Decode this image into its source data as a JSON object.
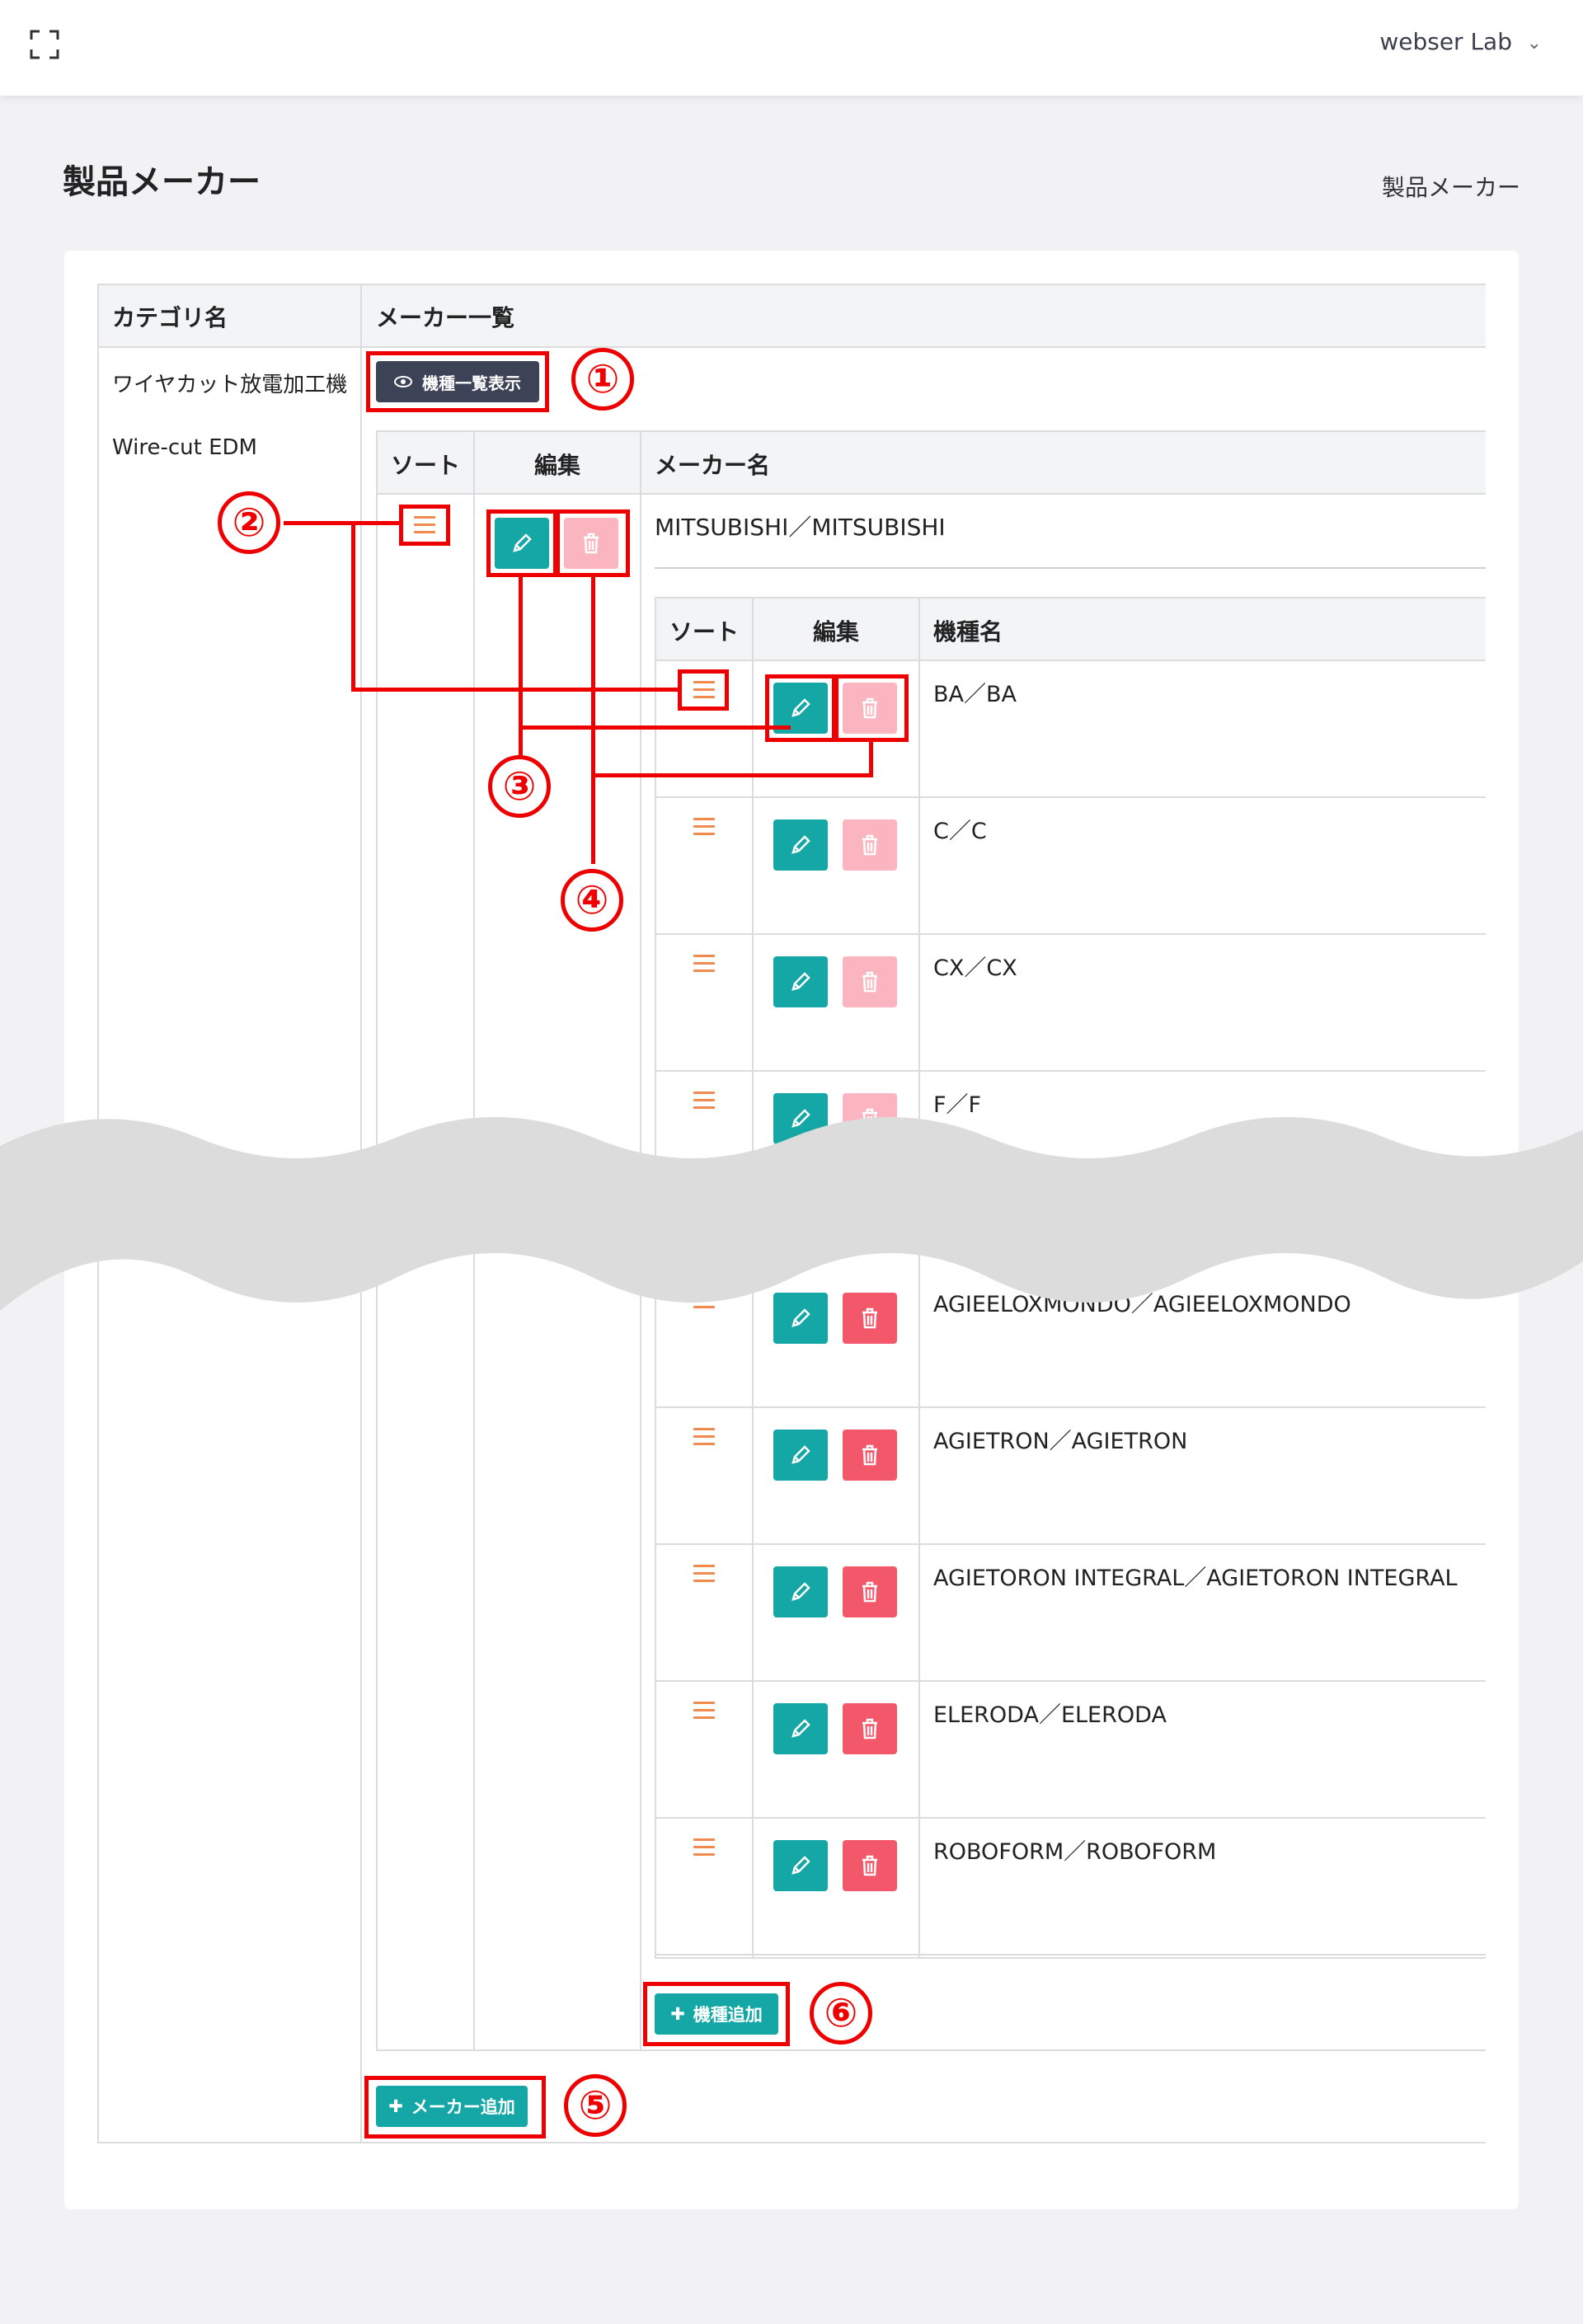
{
  "header": {
    "user_name": "webser Lab"
  },
  "page": {
    "title": "製品メーカー",
    "breadcrumb": "製品メーカー"
  },
  "outer_table": {
    "col_category": "カテゴリ名",
    "col_makers": "メーカー一覧",
    "category_name_ja": "ワイヤカット放電加工機",
    "category_name_en": "Wire-cut EDM",
    "show_models_label": "機種一覧表示",
    "add_maker_label": "メーカー追加"
  },
  "maker_table": {
    "col_sort": "ソート",
    "col_edit": "編集",
    "col_name": "メーカー名",
    "maker_name": "MITSUBISHI／MITSUBISHI"
  },
  "model_table": {
    "col_sort": "ソート",
    "col_edit": "編集",
    "col_name": "機種名",
    "add_model_label": "機種追加",
    "rows_top": [
      {
        "name": "BA／BA",
        "delete_state": "disabled"
      },
      {
        "name": "C／C",
        "delete_state": "disabled"
      },
      {
        "name": "CX／CX",
        "delete_state": "disabled"
      },
      {
        "name": "F／F",
        "delete_state": "disabled"
      }
    ],
    "rows_bottom": [
      {
        "name": "AGIEELOXMONDO／AGIEELOXMONDO",
        "delete_state": "enabled"
      },
      {
        "name": "AGIETRON／AGIETRON",
        "delete_state": "enabled"
      },
      {
        "name": "AGIETORON INTEGRAL／AGIETORON INTEGRAL",
        "delete_state": "enabled"
      },
      {
        "name": "ELERODA／ELERODA",
        "delete_state": "enabled"
      },
      {
        "name": "ROBOFORM／ROBOFORM",
        "delete_state": "enabled"
      }
    ]
  },
  "callouts": [
    "①",
    "②",
    "③",
    "④",
    "⑤",
    "⑥"
  ],
  "colors": {
    "teal": "#15a6a6",
    "dark_button": "#3d4356",
    "delete_disabled": "#fbb5c0",
    "delete_enabled": "#f2586a",
    "sort_orange": "#f08a50",
    "annotation_red": "#e00000"
  },
  "icons": [
    "fullscreen-icon",
    "chevron-down-icon",
    "eye-icon",
    "pencil-icon",
    "trash-icon",
    "plus-icon",
    "sort-handle-icon"
  ]
}
